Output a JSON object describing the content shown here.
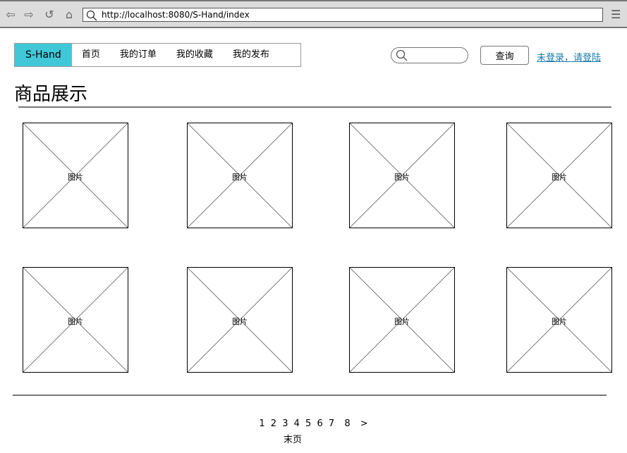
{
  "browser": {
    "url": "http://localhost:8080/S-Hand/index"
  },
  "nav": {
    "brand": "S-Hand",
    "items": [
      "首页",
      "我的订单",
      "我的收藏",
      "我的发布"
    ]
  },
  "search": {
    "placeholder": "",
    "button": "查询"
  },
  "login_link": "未登录，请登陆",
  "page_title": "商品展示",
  "products": [
    "图片",
    "图片",
    "图片",
    "图片",
    "图片",
    "图片",
    "图片",
    "图片"
  ],
  "pagination": {
    "pages": [
      "1",
      "2",
      "3",
      "4",
      "5",
      "6",
      "7",
      "8"
    ],
    "next": ">",
    "last": "末页"
  },
  "colors": {
    "brand": "#40c8d8",
    "link": "#1a7aa8"
  }
}
